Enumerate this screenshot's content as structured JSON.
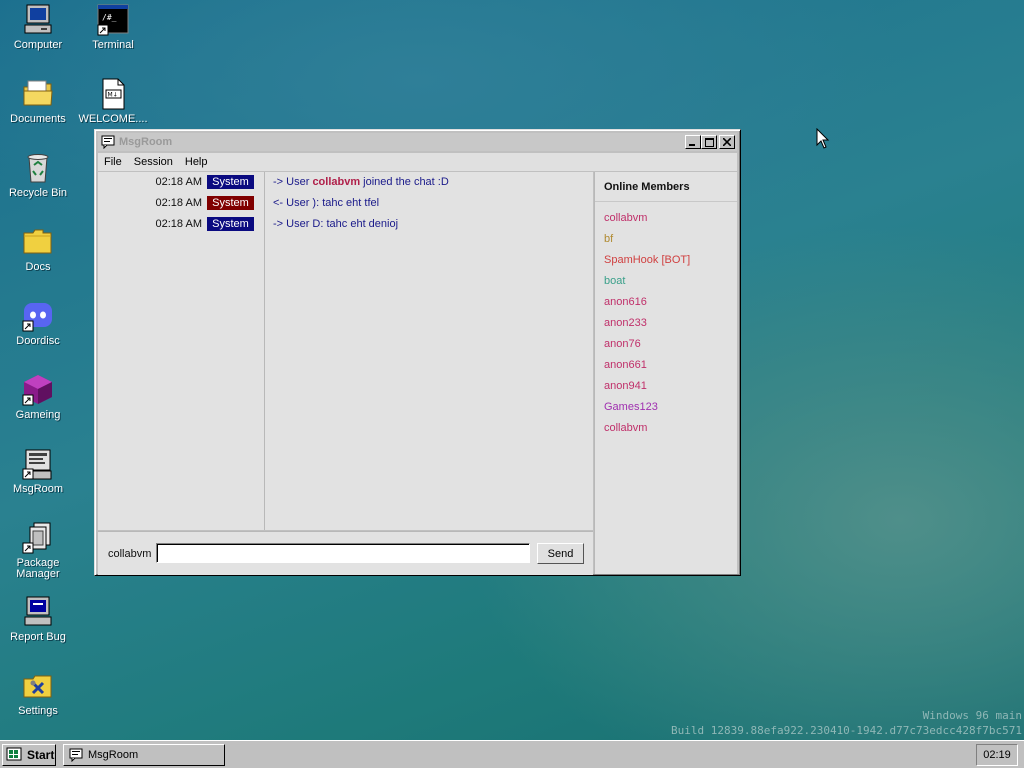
{
  "desktop": {
    "icons": [
      {
        "label": "Computer"
      },
      {
        "label": "Terminal"
      },
      {
        "label": "Documents"
      },
      {
        "label": "WELCOME...."
      },
      {
        "label": "Recycle Bin"
      },
      {
        "label": "Docs"
      },
      {
        "label": "Doordisc"
      },
      {
        "label": "Gameing"
      },
      {
        "label": "MsgRoom"
      },
      {
        "label": "Package Manager"
      },
      {
        "label": "Report Bug"
      },
      {
        "label": "Settings"
      }
    ],
    "watermark": {
      "line1": "Windows 96 main",
      "line2": "Build 12839.88efa922.230410-1942.d77c73edcc428f7bc571"
    }
  },
  "window": {
    "title": "MsgRoom",
    "menu": [
      "File",
      "Session",
      "Help"
    ],
    "messages": [
      {
        "time": "02:18 AM",
        "badge": "System",
        "badge_color": "#0a0a80",
        "prefix": "-> User ",
        "user": "collabvm",
        "suffix": " joined the chat :D"
      },
      {
        "time": "02:18 AM",
        "badge": "System",
        "badge_color": "#800000",
        "prefix": "<- User ): tahc eht tfel",
        "user": "",
        "suffix": ""
      },
      {
        "time": "02:18 AM",
        "badge": "System",
        "badge_color": "#0a0a80",
        "prefix": "-> User D: tahc eht denioj",
        "user": "",
        "suffix": ""
      }
    ],
    "members_title": "Online Members",
    "members": [
      {
        "name": "collabvm",
        "color": "#c0306a"
      },
      {
        "name": "bf",
        "color": "#b08a30"
      },
      {
        "name": "SpamHook [BOT]",
        "color": "#d04040"
      },
      {
        "name": "boat",
        "color": "#3aa08a"
      },
      {
        "name": "anon616",
        "color": "#c0306a"
      },
      {
        "name": "anon233",
        "color": "#c0306a"
      },
      {
        "name": "anon76",
        "color": "#c0306a"
      },
      {
        "name": "anon661",
        "color": "#c0306a"
      },
      {
        "name": "anon941",
        "color": "#c0306a"
      },
      {
        "name": "Games123",
        "color": "#a030b0"
      },
      {
        "name": "collabvm",
        "color": "#c0306a"
      }
    ],
    "nick": "collabvm",
    "input_value": "",
    "send_label": "Send"
  },
  "taskbar": {
    "start_label": "Start",
    "task_label": "MsgRoom",
    "clock": "02:19"
  }
}
